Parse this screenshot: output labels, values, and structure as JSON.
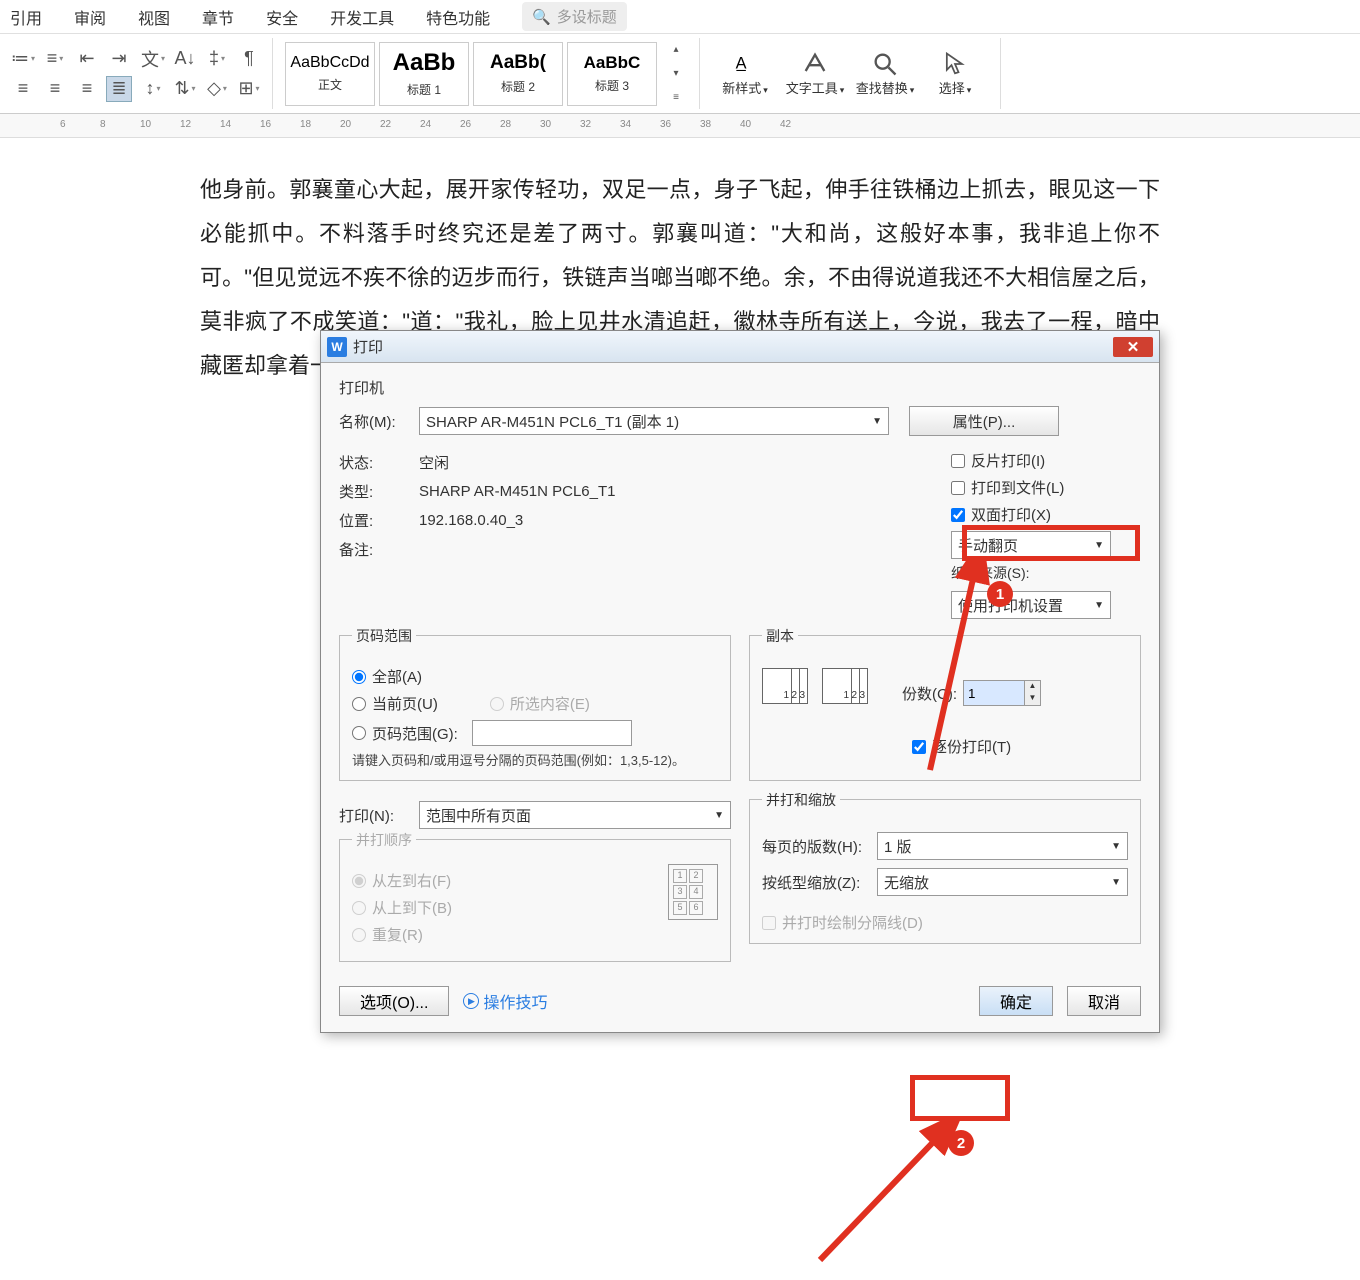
{
  "menu": {
    "items": [
      "引用",
      "审阅",
      "视图",
      "章节",
      "安全",
      "开发工具",
      "特色功能"
    ],
    "search_ph": "多设标题"
  },
  "styles": [
    {
      "preview": "AaBbCcDd",
      "label": "正文"
    },
    {
      "preview": "AaBb",
      "label": "标题 1"
    },
    {
      "preview": "AaBb(",
      "label": "标题 2"
    },
    {
      "preview": "AaBbC",
      "label": "标题 3"
    }
  ],
  "tools": {
    "newstyle": "新样式",
    "texttool": "文字工具",
    "findrep": "查找替换",
    "select": "选择"
  },
  "doc_text": "他身前。郭襄童心大起，展开家传轻功，双足一点，身子飞起，伸手往铁桶边上抓去，眼见这一下必能抓中。不料落手时终究还是差了两寸。郭襄叫道：\"大和尚，这般好本事，我非追上你不可。\"但见觉远不疾不徐的迈步而行，铁链声当啷当啷不绝。余，不由得说道我还不大相信屋之后，莫非疯了不成笑道：\"道：\"我礼，脸上见井水清追赶，徽林寺所有送上，今说，我去了一程，暗中藏匿却拿着一\"大和尚觉远装不成了",
  "dlg": {
    "title": "打印",
    "printer_section": "打印机",
    "name_lbl": "名称(M):",
    "name_val": "SHARP AR-M451N PCL6_T1 (副本 1)",
    "props_btn": "属性(P)...",
    "status_lbl": "状态:",
    "status_val": "空闲",
    "type_lbl": "类型:",
    "type_val": "SHARP AR-M451N PCL6_T1",
    "loc_lbl": "位置:",
    "loc_val": "192.168.0.40_3",
    "comment_lbl": "备注:",
    "inverse": "反片打印(I)",
    "tofile": "打印到文件(L)",
    "duplex": "双面打印(X)",
    "fliptype": "手动翻页",
    "papersrc_lbl": "纸张来源(S):",
    "papersrc_val": "使用打印机设置",
    "range_title": "页码范围",
    "all": "全部(A)",
    "current": "当前页(U)",
    "selection": "所选内容(E)",
    "pagerange": "页码范围(G):",
    "hint": "请键入页码和/或用逗号分隔的页码范围(例如：1,3,5-12)。",
    "copies_title": "副本",
    "copies_lbl": "份数(C):",
    "copies_val": "1",
    "collate": "逐份打印(T)",
    "print_lbl": "打印(N):",
    "print_val": "范围中所有页面",
    "order_title": "并打顺序",
    "ltr": "从左到右(F)",
    "ttb": "从上到下(B)",
    "repeat": "重复(R)",
    "scale_title": "并打和缩放",
    "ppsheet_lbl": "每页的版数(H):",
    "ppsheet_val": "1 版",
    "scale_lbl": "按纸型缩放(Z):",
    "scale_val": "无缩放",
    "drawsep": "并打时绘制分隔线(D)",
    "options": "选项(O)...",
    "tips": "操作技巧",
    "ok": "确定",
    "cancel": "取消"
  },
  "badges": {
    "b1": "1",
    "b2": "2"
  }
}
